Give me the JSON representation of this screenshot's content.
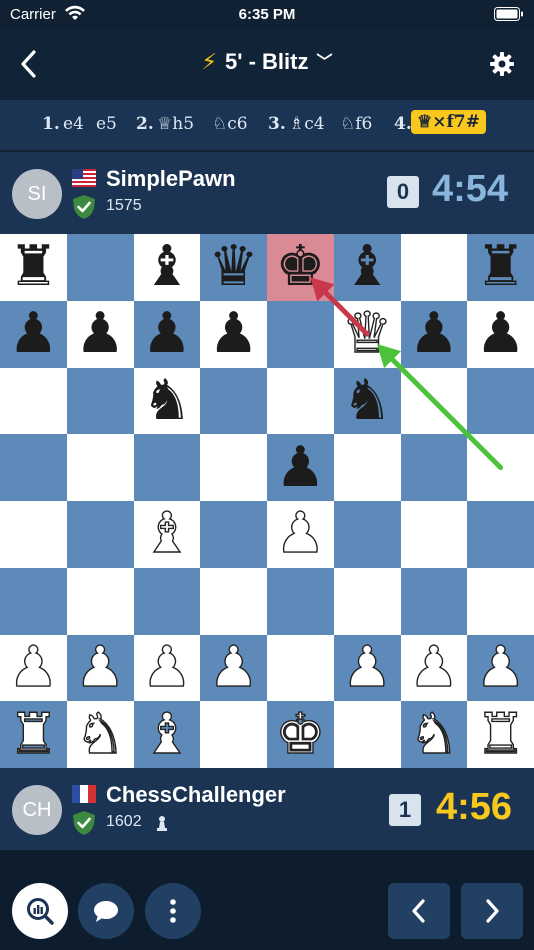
{
  "status_bar": {
    "carrier": "Carrier",
    "time": "6:35 PM"
  },
  "nav": {
    "title": "5' - Blitz",
    "icons": [
      "back-chevron-icon",
      "bolt-icon",
      "chevron-down-icon",
      "gear-icon"
    ]
  },
  "moves": [
    {
      "num": "1.",
      "white": "e4",
      "black": "e5"
    },
    {
      "num": "2.",
      "white": "♕h5",
      "black": "♘c6"
    },
    {
      "num": "3.",
      "white": "♗c4",
      "black": "♘f6"
    },
    {
      "num": "4.",
      "white": "♕×f7#",
      "current": true
    }
  ],
  "top_player": {
    "initials": "SI",
    "name": "SimplePawn",
    "rating": "1575",
    "country": "US",
    "score": "0",
    "clock": "4:54"
  },
  "bottom_player": {
    "initials": "CH",
    "name": "ChessChallenger",
    "rating": "1602",
    "country": "FR",
    "score": "1",
    "clock": "4:56"
  },
  "board": {
    "ranks": [
      [
        "r",
        "",
        "b",
        "q",
        "k",
        "b",
        "",
        "r"
      ],
      [
        "p",
        "p",
        "p",
        "p",
        "",
        "Q",
        "p",
        "p"
      ],
      [
        "",
        "",
        "n",
        "",
        "",
        "n",
        "",
        ""
      ],
      [
        "",
        "",
        "",
        "",
        "p",
        "",
        "",
        ""
      ],
      [
        "",
        "",
        "B",
        "",
        "P",
        "",
        "",
        ""
      ],
      [
        "",
        "",
        "",
        "",
        "",
        "",
        "",
        ""
      ],
      [
        "P",
        "P",
        "P",
        "P",
        "",
        "P",
        "P",
        "P"
      ],
      [
        "R",
        "N",
        "B",
        "",
        "K",
        "",
        "N",
        "R"
      ]
    ],
    "highlight": "e8",
    "arrows": [
      {
        "from": "f7",
        "to": "e8",
        "color": "#c8374a"
      },
      {
        "from": "h5",
        "to": "f7",
        "color": "#4cc13a"
      }
    ],
    "colors": {
      "light": "#ffffff",
      "dark": "#5d8ab8",
      "highlight": "#d98a95"
    }
  },
  "toolbar": {
    "icons": [
      "analysis-icon",
      "chat-icon",
      "more-icon",
      "previous-icon",
      "next-icon"
    ]
  },
  "colors": {
    "background": "#112235",
    "panel": "#1b3453",
    "accent": "#f8c81c",
    "clock_top": "#8ab6de"
  }
}
